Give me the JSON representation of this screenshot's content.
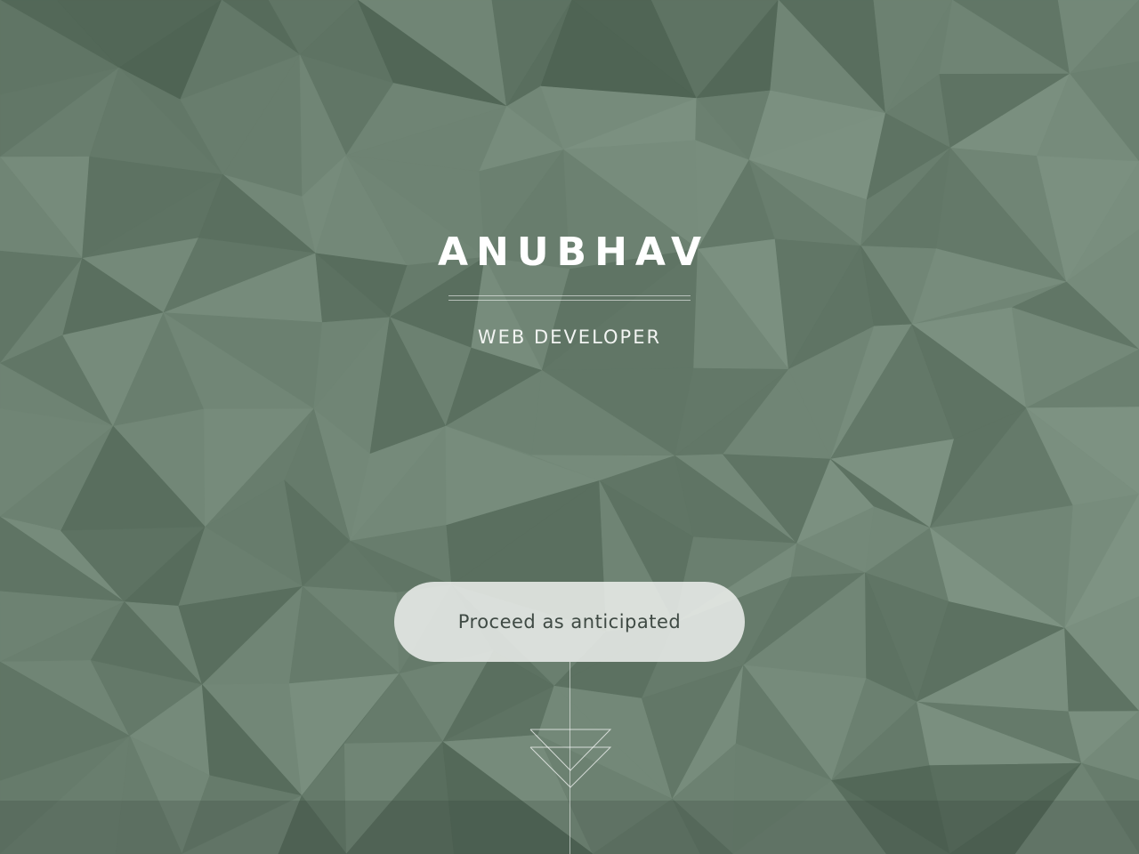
{
  "hero": {
    "name": "ANUBHAV",
    "role": "WEB DEVELOPER"
  },
  "cta": {
    "label": "Proceed as anticipated"
  },
  "colors": {
    "background": "#66776b",
    "title_text": "#ffffff",
    "button_bg": "#eceeec",
    "button_text": "#3f4a44"
  },
  "icons": {
    "scroll_indicator": "double-chevron-down-icon"
  }
}
